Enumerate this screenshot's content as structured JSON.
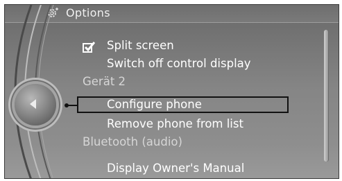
{
  "header": {
    "title": "Options",
    "icon": "options-gear-icon"
  },
  "menu": {
    "split_screen": {
      "label": "Split screen",
      "checked": true
    },
    "switch_off_display": {
      "label": "Switch off control display"
    },
    "section_device": {
      "label": "Gerät 2"
    },
    "configure_phone": {
      "label": "Configure phone",
      "selected": true
    },
    "remove_phone": {
      "label": "Remove phone from list"
    },
    "section_bluetooth": {
      "label": "Bluetooth (audio)"
    },
    "owners_manual": {
      "label": "Display Owner's Manual"
    }
  },
  "controller": {
    "icon": "controller-left-arrow-icon"
  }
}
